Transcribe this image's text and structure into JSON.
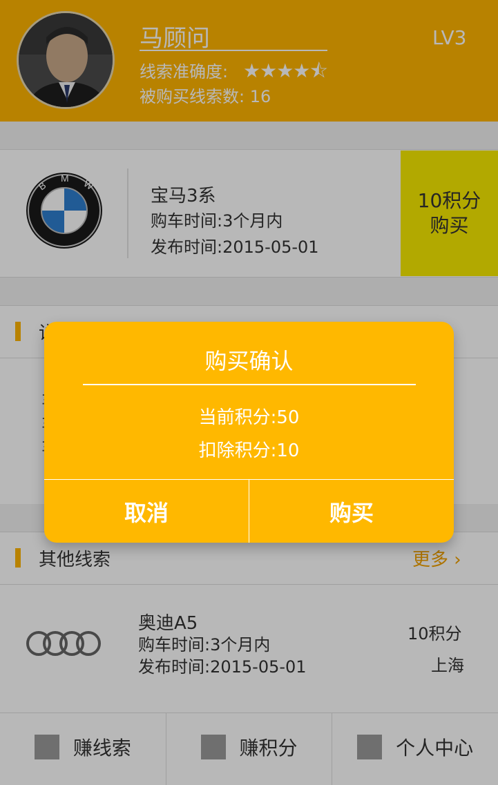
{
  "profile": {
    "name": "马顾问",
    "level": "LV3",
    "accuracy_label": "线索准确度:",
    "accuracy_rating": 4.5,
    "accuracy_stars": "★★★★⯪",
    "sold_label": "被购买线索数: 16"
  },
  "lead": {
    "brand_icon": "bmw-logo-icon",
    "title": "宝马3系",
    "purchase_time": "购车时间:3个月内",
    "publish_time": "发布时间:2015-05-01",
    "price": "10积分",
    "buy_label": "购买"
  },
  "detail_section": {
    "title": "详细信息",
    "lines": [
      "车",
      "车",
      "车"
    ]
  },
  "other_section": {
    "title": "其他线索",
    "more_label": "更多",
    "items": [
      {
        "brand_icon": "audi-logo-icon",
        "title": "奥迪A5",
        "purchase_time": "购车时间:3个月内",
        "publish_time": "发布时间:2015-05-01",
        "price": "10积分",
        "city": "上海"
      }
    ]
  },
  "nav": {
    "items": [
      {
        "label": "赚线索",
        "icon": "placeholder-icon"
      },
      {
        "label": "赚积分",
        "icon": "placeholder-icon"
      },
      {
        "label": "个人中心",
        "icon": "placeholder-icon"
      }
    ]
  },
  "dialog": {
    "title": "购买确认",
    "current_points": "当前积分:50",
    "deduct_points": "扣除积分:10",
    "cancel_label": "取消",
    "confirm_label": "购买"
  },
  "colors": {
    "accent": "#ffb400",
    "buy_box": "#f7ea00",
    "more_link": "#f0a000",
    "dialog_bg": "#ffb800"
  }
}
